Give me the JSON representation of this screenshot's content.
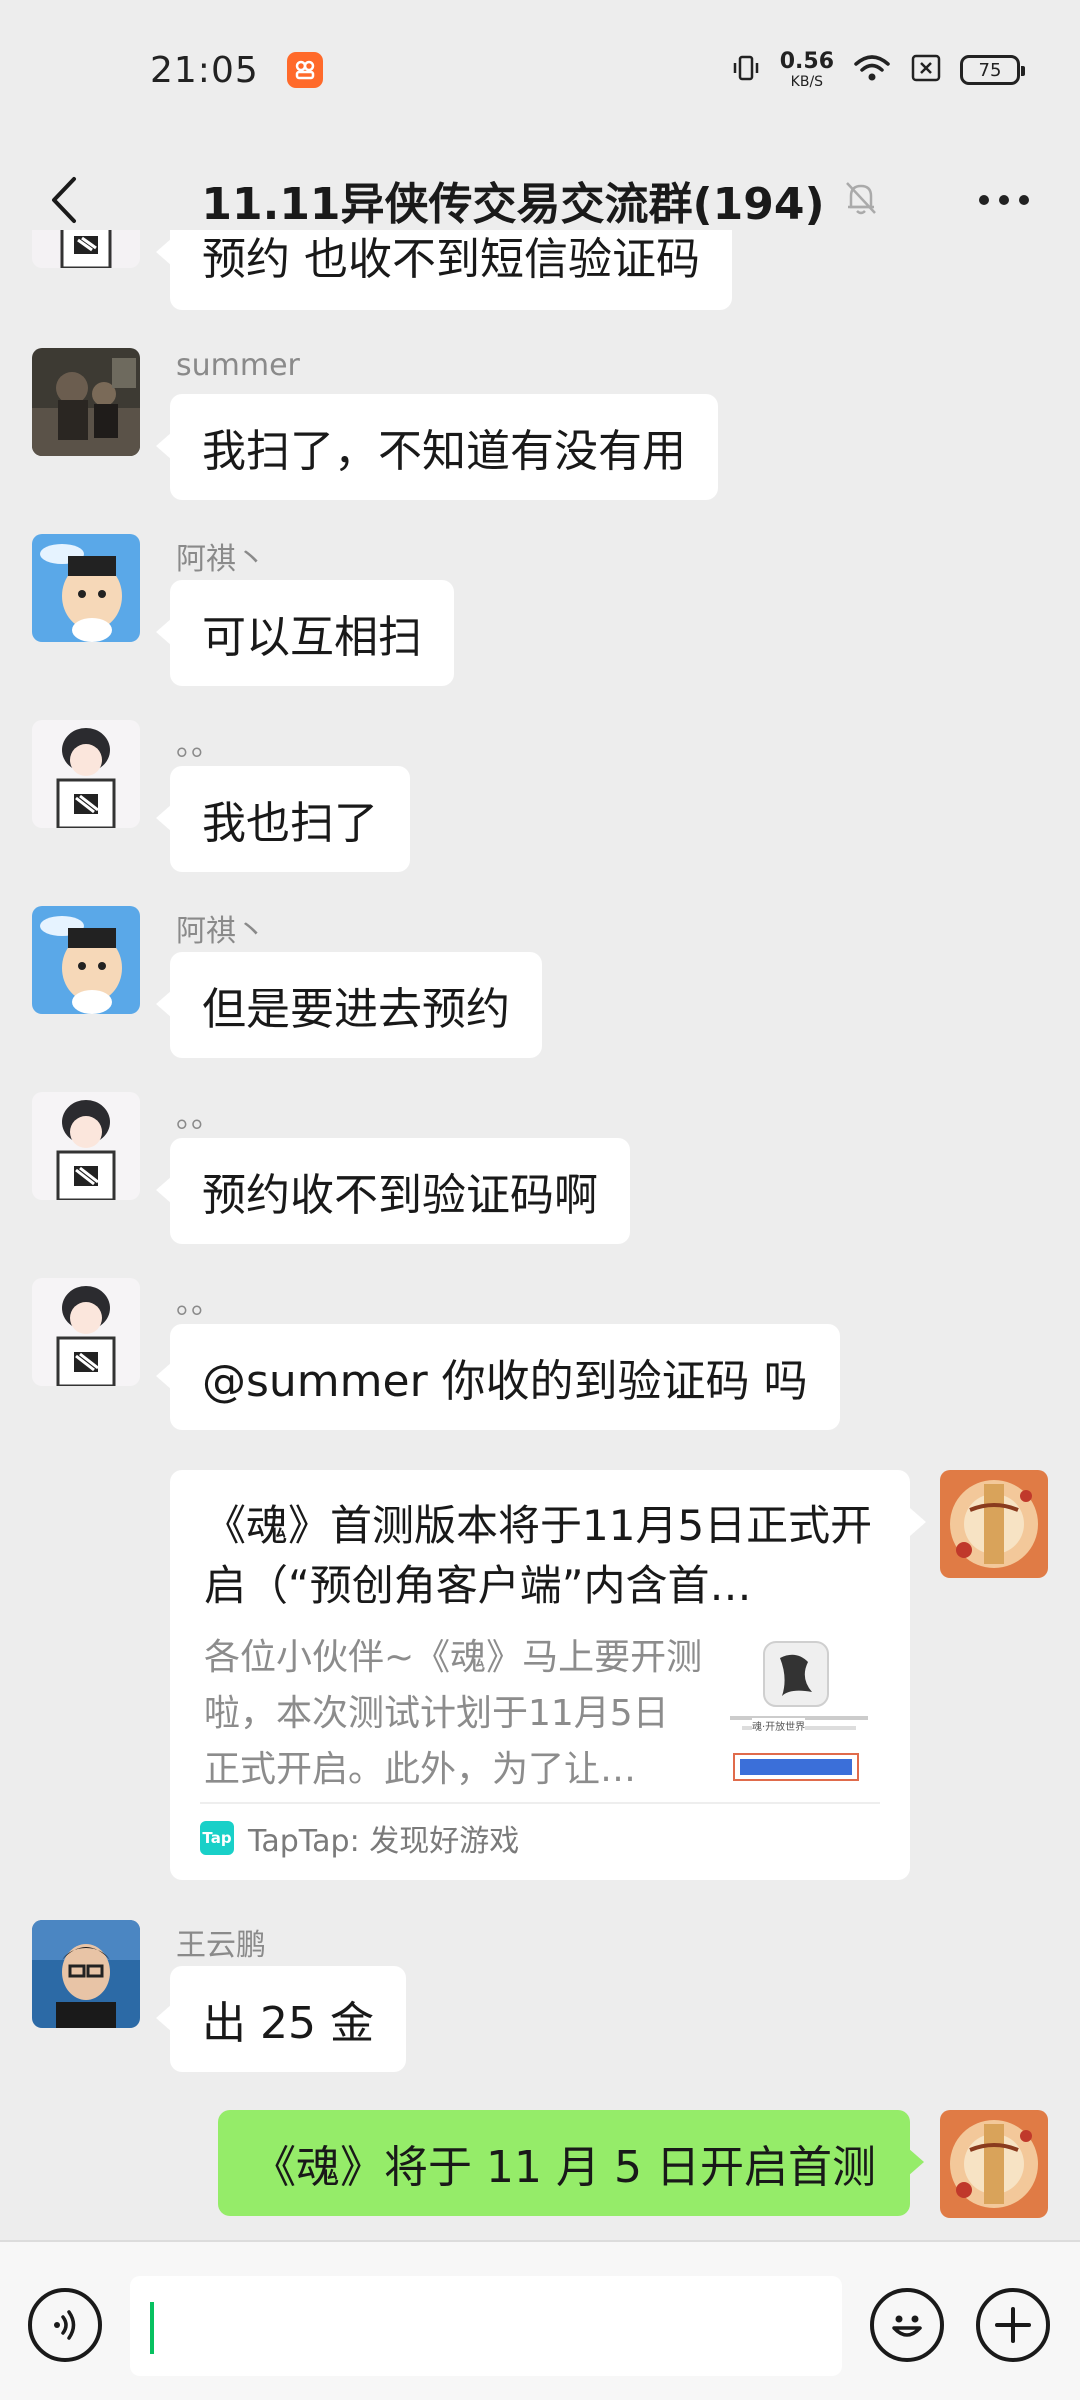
{
  "status_bar": {
    "time": "21:05",
    "net_speed_value": "0.56",
    "net_speed_unit": "KB/S",
    "battery": "75",
    "icons": [
      "vibrate-icon",
      "wifi-icon",
      "no-sim-icon",
      "battery-icon"
    ]
  },
  "header": {
    "title": "11.11异侠传交易交流群(194)",
    "muted_icon": "mute-bell-icon",
    "back_icon": "chevron-left-icon",
    "more_icon": "more-dots-icon"
  },
  "messages": [
    {
      "sender": "",
      "text": "预约  也收不到短信验证码"
    },
    {
      "sender": "summer",
      "text": "我扫了，不知道有没有用"
    },
    {
      "sender": "阿祺丶",
      "text": "可以互相扫"
    },
    {
      "sender": "。。",
      "text": "我也扫了"
    },
    {
      "sender": "阿祺丶",
      "text": "但是要进去预约"
    },
    {
      "sender": "。。",
      "text": "预约收不到验证码啊"
    },
    {
      "sender": "。。",
      "text": "@summer  你收的到验证码   吗"
    },
    {
      "sender": "王云鹏",
      "text": "出 25 金"
    }
  ],
  "link_card": {
    "title": "《魂》首测版本将于11月5日正式开启（“预创角客户端”内含首…",
    "description": "各位小伙伴~《魂》马上要开测啦，本次测试计划于11月5日正式开启。此外，为了让…",
    "source_logo": "Tap",
    "source": "TapTap: 发现好游戏",
    "thumb_caption": "魂·开放世界"
  },
  "self_message": {
    "text": "《魂》将于 11 月 5 日开启首测"
  },
  "input_bar": {
    "voice_icon": "voice-icon",
    "emoji_icon": "emoji-icon",
    "plus_icon": "plus-icon",
    "input_value": ""
  },
  "colors": {
    "background": "#ededed",
    "self_bubble": "#95ec69",
    "other_bubble": "#ffffff",
    "caret": "#07c160"
  }
}
